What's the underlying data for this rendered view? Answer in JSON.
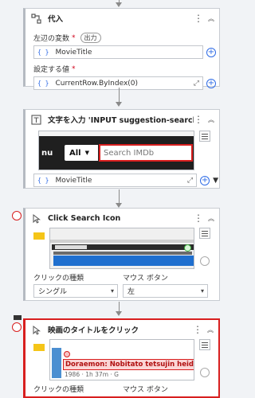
{
  "assign_card": {
    "title": "代入",
    "left_label": "左辺の変数",
    "left_required": "*",
    "left_badge": "出力",
    "left_value": "MovieTitle",
    "right_label": "設定する値",
    "right_required": "*",
    "right_value": "CurrentRow.ByIndex(0)"
  },
  "type_card": {
    "title": "文字を入力 'INPUT  suggestion-search'",
    "thumb_nu": "nu",
    "thumb_all": "All",
    "thumb_placeholder": "Search IMDb",
    "value": "MovieTitle"
  },
  "click_search_card": {
    "title": "Click Search Icon",
    "click_type_label": "クリックの種類",
    "click_type_value": "シングル",
    "mouse_button_label": "マウス ボタン",
    "mouse_button_value": "左"
  },
  "click_title_card": {
    "title": "映画のタイトルをクリック",
    "thumb_title": "Doraemon: Nobitato tetsujin heidan",
    "thumb_meta": "1986 · 1h 37m · G",
    "click_type_label": "クリックの種類",
    "mouse_button_label": "マウス ボタン"
  },
  "icons": {
    "kebab": "⋮",
    "collapse": "︽",
    "curly": "{ }",
    "plus": "+",
    "expand": "⤢",
    "chevron": "▾"
  }
}
